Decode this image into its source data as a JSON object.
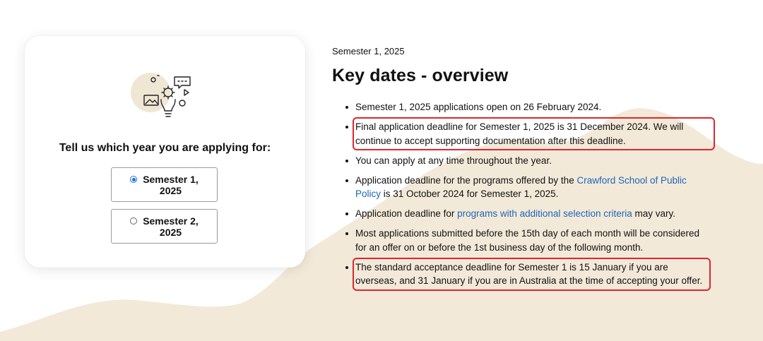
{
  "colors": {
    "accent": "#1a67b8",
    "wave": "#f3e9d8",
    "highlight_box": "#e0252f",
    "illustration_bg": "#f0e6d4"
  },
  "selector": {
    "heading": "Tell us which year you are applying for:",
    "icon": "ideas-lightbulb-illustration",
    "options": [
      {
        "line1": "Semester 1,",
        "line2": "2025",
        "selected": true
      },
      {
        "line1": "Semester 2,",
        "line2": "2025",
        "selected": false
      }
    ]
  },
  "content": {
    "eyebrow": "Semester 1, 2025",
    "title": "Key dates - overview",
    "items": [
      {
        "text": "Semester 1, 2025 applications open on 26 February 2024."
      },
      {
        "text": "Final application deadline for Semester 1, 2025 is 31 December 2024. We will continue to accept supporting documentation after this deadline.",
        "highlighted": true
      },
      {
        "text": "You can apply at any time throughout the year."
      },
      {
        "before": "Application deadline for the programs offered by the ",
        "link": "Crawford School of Public Policy",
        "after": " is 31 October 2024 for Semester 1, 2025."
      },
      {
        "before": "Application deadline for ",
        "link": "programs with additional selection criteria",
        "after": " may vary."
      },
      {
        "text": "Most applications submitted before the 15th day of each month will be considered for an offer on or before the 1st business day of the following month."
      },
      {
        "text": "The standard acceptance deadline for Semester 1 is 15 January if you are overseas, and 31 January if you are in Australia at the time of accepting your offer.",
        "highlighted": true
      }
    ]
  }
}
